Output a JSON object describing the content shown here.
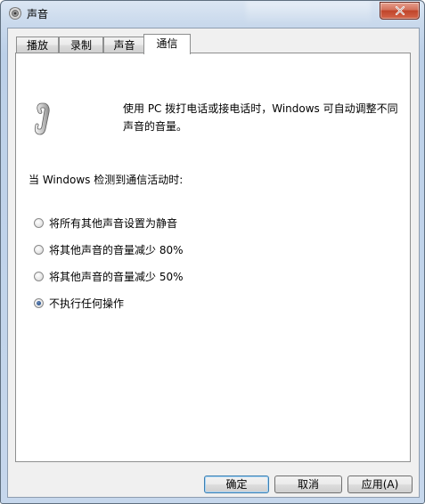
{
  "window": {
    "title": "声音",
    "title_icon": "speaker-control-panel-icon",
    "close_icon": "close-icon"
  },
  "tabs": [
    {
      "label": "播放",
      "active": false
    },
    {
      "label": "录制",
      "active": false
    },
    {
      "label": "声音",
      "active": false
    },
    {
      "label": "通信",
      "active": true
    }
  ],
  "communications": {
    "icon": "telephone-icon",
    "description": "使用 PC 拨打电话或接电话时，Windows 可自动调整不同声音的音量。",
    "prompt": "当 Windows 检测到通信活动时:",
    "options": [
      {
        "label": "将所有其他声音设置为静音",
        "checked": false
      },
      {
        "label": "将其他声音的音量减少 80%",
        "checked": false
      },
      {
        "label": "将其他声音的音量减少 50%",
        "checked": false
      },
      {
        "label": "不执行任何操作",
        "checked": true
      }
    ]
  },
  "buttons": {
    "ok": "确定",
    "cancel": "取消",
    "apply": "应用(A)"
  },
  "colors": {
    "title_bar": "#c9d9ec",
    "close_button": "#c0442a",
    "radio_dot": "#1d4a88",
    "default_button_border": "#3c7fb1"
  }
}
